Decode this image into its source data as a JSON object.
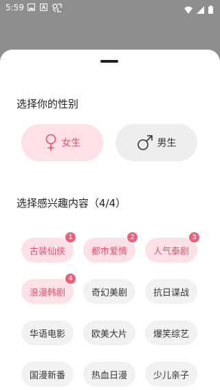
{
  "status": {
    "time": "5:59"
  },
  "gender_section": {
    "title": "选择你的性别"
  },
  "gender_options": [
    {
      "label": "女生",
      "selected": true,
      "icon": "female-icon"
    },
    {
      "label": "男生",
      "selected": false,
      "icon": "male-icon"
    }
  ],
  "interest_section": {
    "title": "选择感兴趣内容（4/4）"
  },
  "interests": [
    {
      "label": "古装仙侠",
      "selected": true,
      "order": "1"
    },
    {
      "label": "都市爱情",
      "selected": true,
      "order": "2"
    },
    {
      "label": "人气泰剧",
      "selected": true,
      "order": "3"
    },
    {
      "label": "浪漫韩剧",
      "selected": true,
      "order": "4"
    },
    {
      "label": "奇幻美剧",
      "selected": false
    },
    {
      "label": "抗日谍战",
      "selected": false
    },
    {
      "label": "华语电影",
      "selected": false
    },
    {
      "label": "欧美大片",
      "selected": false
    },
    {
      "label": "爆笑综艺",
      "selected": false
    },
    {
      "label": "国漫新番",
      "selected": false
    },
    {
      "label": "热血日漫",
      "selected": false
    },
    {
      "label": "少儿亲子",
      "selected": false
    }
  ],
  "colors": {
    "accent": "#e8506e",
    "accent_bg": "#fde1e6",
    "badge": "#f0607a",
    "overlay": "#8e8e8e"
  }
}
